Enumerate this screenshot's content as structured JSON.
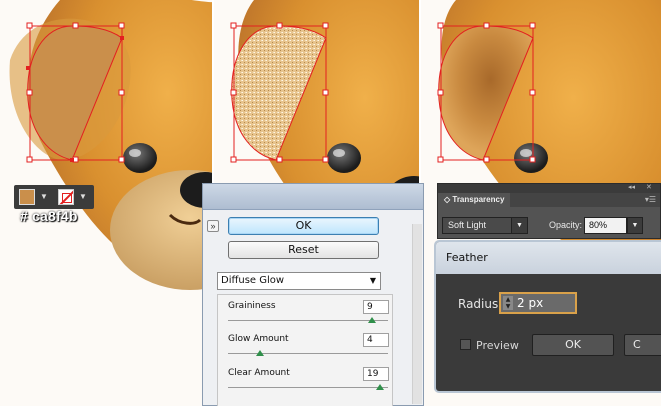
{
  "colors": {
    "fur": "#ca8f4b",
    "selection": "#e32020",
    "fill_swatch": "#ca8f4b"
  },
  "swatch": {
    "hex_label": "# ca8f4b"
  },
  "glow_dialog": {
    "ok_label": "OK",
    "reset_label": "Reset",
    "filter_name": "Diffuse Glow",
    "params": [
      {
        "label": "Graininess",
        "value": "9",
        "slider_fraction": 0.9
      },
      {
        "label": "Glow Amount",
        "value": "4",
        "slider_fraction": 0.2
      },
      {
        "label": "Clear Amount",
        "value": "19",
        "slider_fraction": 0.95
      }
    ]
  },
  "transparency_panel": {
    "tab_label": "◇ Transparency",
    "blend_mode": "Soft Light",
    "opacity_label": "Opacity:",
    "opacity_value": "80%"
  },
  "feather_dialog": {
    "title": "Feather",
    "radius_label": "Radius:",
    "radius_value": "2 px",
    "preview_label": "Preview",
    "ok_label": "OK",
    "cancel_label": "C"
  }
}
